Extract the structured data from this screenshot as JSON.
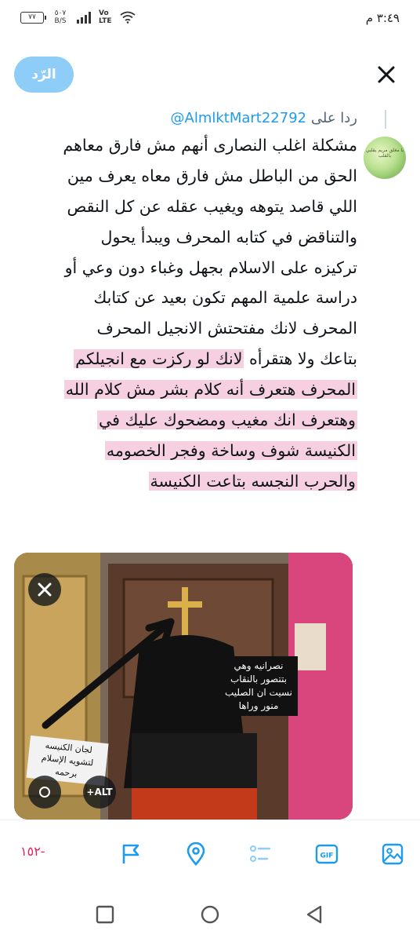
{
  "status_bar": {
    "time": "٣:٤٩ م",
    "battery": "٧٧",
    "network_speed_value": "٥٠٧",
    "network_speed_unit": "B/S",
    "volte_top": "Vo",
    "volte_bottom": "LTE"
  },
  "header": {
    "reply_button": "الرّد",
    "close_icon": "close-icon"
  },
  "reply_to": {
    "prefix": "ردا على",
    "handle": "@AlmlktMart22792"
  },
  "avatar": {
    "text": "يا مغلق مريم بقلبي بالقلب"
  },
  "tweet": {
    "lines": [
      "مشكلة اغلب النصارى أنهم مش فارق معاهم",
      "الحق من الباطل مش فارق معاه يعرف مين",
      "اللي قاصد يتوهه ويغيب عقله عن كل النقص",
      "والتناقض في كتابه المحرف ويبدأ يحول",
      "تركيزه على الاسلام بجهل وغباء دون وعي أو",
      "دراسة علمية المهم تكون بعيد عن كتابك",
      "المحرف لانك مفتحتش الانجيل المحرف"
    ],
    "mixed_line": {
      "plain": "بتاعك ولا هتقرأه",
      "highlighted": "لانك لو ركزت مع انجيلكم"
    },
    "highlighted_lines": [
      "المحرف هتعرف أنه كلام بشر مش كلام الله",
      "وهتعرف انك مغيب ومضحوك عليك في",
      "الكنيسة شوف وساخة وفجر الخصومه",
      "والحرب النجسه بتاعت الكنيسة"
    ],
    "highlight_color": "#f6cfe0"
  },
  "media": {
    "alt_label": "+ALT",
    "caption_black": [
      "نصرانيه وهي",
      "بتتصور بالنقاب",
      "نسيت ان الصليب",
      "منور وراها"
    ],
    "caption_paper": [
      "لجان الكنيسه",
      "لتشويه الإسلام",
      "برحمه"
    ]
  },
  "toolbar": {
    "counter": "١٥٢-",
    "accent_color": "#1d9bf0",
    "counter_color": "#e0245e",
    "gif_label": "GIF"
  },
  "icons": {
    "image": "image-icon",
    "gif": "gif-icon",
    "poll": "poll-icon",
    "location": "location-icon",
    "flag": "flag-icon"
  }
}
